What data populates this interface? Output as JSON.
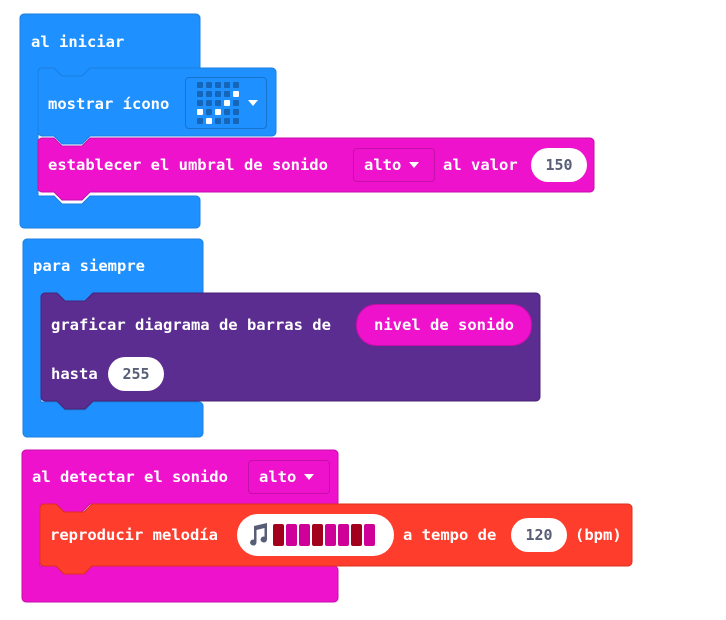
{
  "on_start": {
    "hat_label": "al iniciar",
    "show_icon": {
      "label": "mostrar ícono",
      "icon": "yes-checkmark-icon"
    },
    "set_threshold": {
      "label_before": "establecer el umbral de sonido",
      "level": "alto",
      "label_after": "al valor",
      "value": "150"
    }
  },
  "forever": {
    "hat_label": "para siempre",
    "plot_bar": {
      "label": "graficar diagrama de barras de",
      "reporter": "nivel de sonido",
      "up_to_label": "hasta",
      "up_to_value": "255"
    }
  },
  "on_sound": {
    "hat_label": "al detectar el sonido",
    "level": "alto",
    "play_melody": {
      "label": "reproducir melodía",
      "tempo_label": "a tempo de",
      "tempo_value": "120",
      "unit": "(bpm)"
    },
    "melody_notes": [
      "#a3001e",
      "#ce0098",
      "#ce0098",
      "#a3001e",
      "#ce0098",
      "#ce0098",
      "#a3001e",
      "#ce0098"
    ]
  },
  "colors": {
    "basic_blue": "#1e90ff",
    "music_red": "#ff3d2c",
    "input_magenta": "#ee12cc",
    "led_purple": "#5c2d91"
  }
}
